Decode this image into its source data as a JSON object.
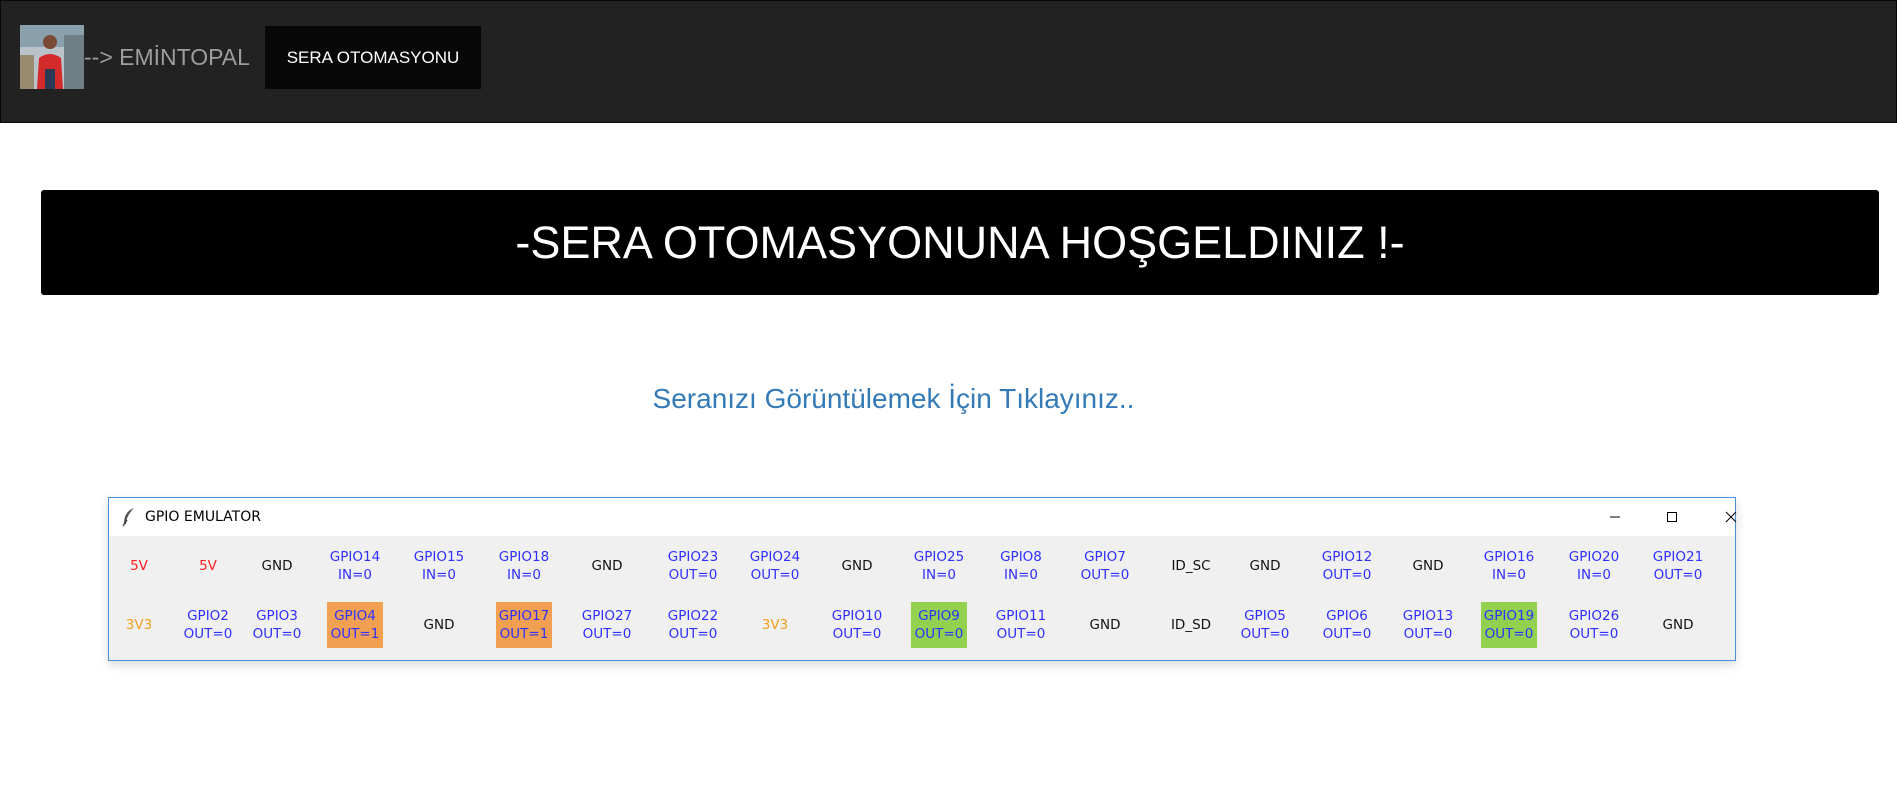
{
  "navbar": {
    "brand": "--> EMİNTOPAL",
    "active_item": "SERA OTOMASYONU"
  },
  "banner": {
    "title": "-SERA OTOMASYONUNA HOŞGELDINIZ !-"
  },
  "link": {
    "text": "Seranızı Görüntülemek İçin Tıklayınız.."
  },
  "emulator": {
    "title": "GPIO EMULATOR",
    "top_row": [
      {
        "l1": "5V",
        "l2": "",
        "color": "red",
        "style": "flat"
      },
      {
        "l1": "5V",
        "l2": "",
        "color": "red",
        "style": "flat"
      },
      {
        "l1": "GND",
        "l2": "",
        "color": "black",
        "style": "flat"
      },
      {
        "l1": "GPIO14",
        "l2": "IN=0",
        "color": "blue",
        "style": "button"
      },
      {
        "l1": "GPIO15",
        "l2": "IN=0",
        "color": "blue",
        "style": "button"
      },
      {
        "l1": "GPIO18",
        "l2": "IN=0",
        "color": "blue",
        "style": "button"
      },
      {
        "l1": "GND",
        "l2": "",
        "color": "black",
        "style": "flat"
      },
      {
        "l1": "GPIO23",
        "l2": "OUT=0",
        "color": "blue",
        "style": "flat"
      },
      {
        "l1": "GPIO24",
        "l2": "OUT=0",
        "color": "blue",
        "style": "flat"
      },
      {
        "l1": "GND",
        "l2": "",
        "color": "black",
        "style": "flat"
      },
      {
        "l1": "GPIO25",
        "l2": "IN=0",
        "color": "blue",
        "style": "button"
      },
      {
        "l1": "GPIO8",
        "l2": "IN=0",
        "color": "blue",
        "style": "button"
      },
      {
        "l1": "GPIO7",
        "l2": "OUT=0",
        "color": "blue",
        "style": "flat"
      },
      {
        "l1": "ID_SC",
        "l2": "",
        "color": "black",
        "style": "flat"
      },
      {
        "l1": "GND",
        "l2": "",
        "color": "black",
        "style": "flat"
      },
      {
        "l1": "GPIO12",
        "l2": "OUT=0",
        "color": "blue",
        "style": "flat"
      },
      {
        "l1": "GND",
        "l2": "",
        "color": "black",
        "style": "flat"
      },
      {
        "l1": "GPIO16",
        "l2": "IN=0",
        "color": "blue",
        "style": "button"
      },
      {
        "l1": "GPIO20",
        "l2": "IN=0",
        "color": "blue",
        "style": "button"
      },
      {
        "l1": "GPIO21",
        "l2": "OUT=0",
        "color": "blue",
        "style": "flat"
      }
    ],
    "bottom_row": [
      {
        "l1": "3V3",
        "l2": "",
        "color": "orange",
        "style": "flat"
      },
      {
        "l1": "GPIO2",
        "l2": "OUT=0",
        "color": "blue",
        "style": "flat"
      },
      {
        "l1": "GPIO3",
        "l2": "OUT=0",
        "color": "blue",
        "style": "flat"
      },
      {
        "l1": "GPIO4",
        "l2": "OUT=1",
        "color": "blue",
        "style": "orange"
      },
      {
        "l1": "GND",
        "l2": "",
        "color": "black",
        "style": "flat"
      },
      {
        "l1": "GPIO17",
        "l2": "OUT=1",
        "color": "blue",
        "style": "orange"
      },
      {
        "l1": "GPIO27",
        "l2": "OUT=0",
        "color": "blue",
        "style": "flat"
      },
      {
        "l1": "GPIO22",
        "l2": "OUT=0",
        "color": "blue",
        "style": "flat"
      },
      {
        "l1": "3V3",
        "l2": "",
        "color": "orange",
        "style": "flat"
      },
      {
        "l1": "GPIO10",
        "l2": "OUT=0",
        "color": "blue",
        "style": "flat"
      },
      {
        "l1": "GPIO9",
        "l2": "OUT=0",
        "color": "blue",
        "style": "green"
      },
      {
        "l1": "GPIO11",
        "l2": "OUT=0",
        "color": "blue",
        "style": "flat"
      },
      {
        "l1": "GND",
        "l2": "",
        "color": "black",
        "style": "flat"
      },
      {
        "l1": "ID_SD",
        "l2": "",
        "color": "black",
        "style": "flat"
      },
      {
        "l1": "GPIO5",
        "l2": "OUT=0",
        "color": "blue",
        "style": "flat"
      },
      {
        "l1": "GPIO6",
        "l2": "OUT=0",
        "color": "blue",
        "style": "flat"
      },
      {
        "l1": "GPIO13",
        "l2": "OUT=0",
        "color": "blue",
        "style": "flat"
      },
      {
        "l1": "GPIO19",
        "l2": "OUT=0",
        "color": "blue",
        "style": "green"
      },
      {
        "l1": "GPIO26",
        "l2": "OUT=0",
        "color": "blue",
        "style": "flat"
      },
      {
        "l1": "GND",
        "l2": "",
        "color": "black",
        "style": "flat"
      }
    ]
  },
  "colors": {
    "link": "#337ab7",
    "navbar": "#222222",
    "output_high": "#f0a050",
    "output_green": "#92d050",
    "label_blue": "#3030ff",
    "power_red": "#ff2020",
    "power_orange": "#f0a020"
  }
}
